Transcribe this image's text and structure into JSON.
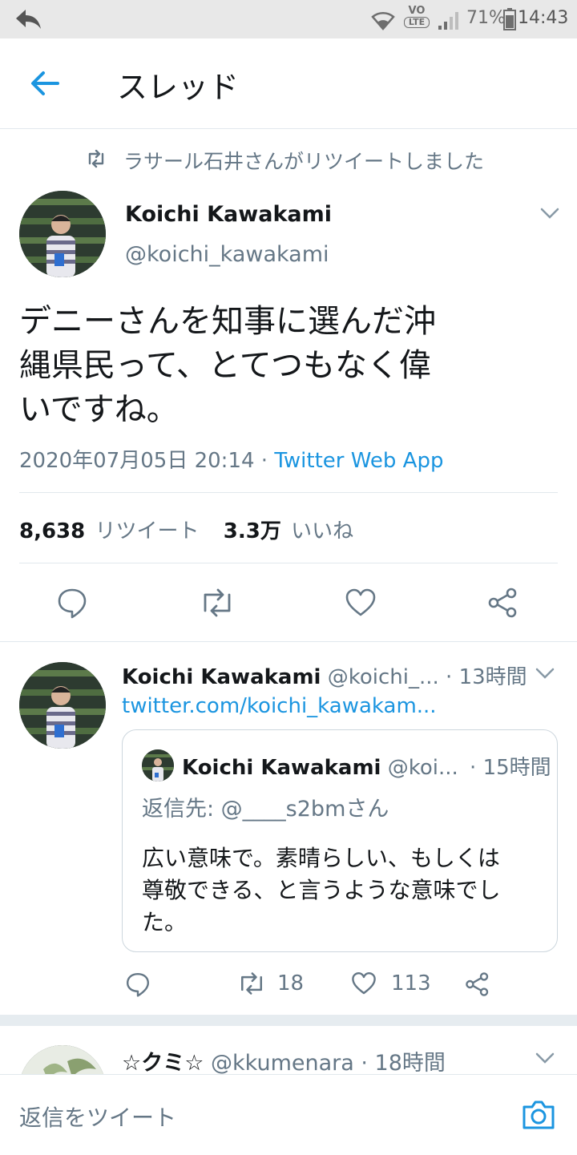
{
  "status_bar": {
    "lte_label": "LTE",
    "vo_label": "VO",
    "battery": "71%",
    "time": "14:43"
  },
  "header": {
    "title": "スレッド"
  },
  "retweet_banner": {
    "text": "ラサール石井さんがリツイートしました"
  },
  "main_tweet": {
    "name": "Koichi Kawakami",
    "handle": "@koichi_kawakami",
    "text_lines": [
      "デニーさんを知事に選んだ沖",
      "縄県民って、とてつもなく偉",
      "いですね。"
    ],
    "timestamp": "2020年07月05日 20:14",
    "separator": "·",
    "source": "Twitter Web App",
    "retweet_count": "8,638",
    "retweet_label": "リツイート",
    "like_count": "3.3万",
    "like_label": "いいね"
  },
  "reply_tweet": {
    "name": "Koichi Kawakami",
    "handle": "@koichi_...",
    "time": "· 13時間",
    "link": "twitter.com/koichi_kawakam...",
    "quote": {
      "name": "Koichi Kawakami",
      "handle": "@koi...",
      "time": "· 15時間",
      "reply_to": "返信先: @____s2bmさん",
      "text_lines": [
        "広い意味で。素晴らしい、もしくは",
        "尊敬できる、と言うような意味でし",
        "た。"
      ]
    },
    "retweets": "18",
    "likes": "113"
  },
  "next_tweet": {
    "name": "☆クミ☆",
    "handle": "@kkumenara",
    "time": "· 18時間"
  },
  "compose": {
    "placeholder": "返信をツイート"
  },
  "colors": {
    "accent": "#1b95e0",
    "muted": "#657786",
    "divider": "#e1e8ed"
  }
}
